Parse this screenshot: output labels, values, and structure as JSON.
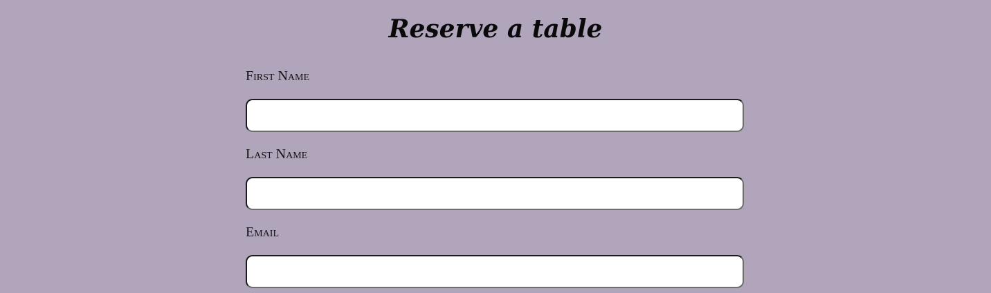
{
  "page": {
    "title": "Reserve a table",
    "background_color": "#b0a5ba"
  },
  "form": {
    "fields": [
      {
        "label": "First Name",
        "value": "",
        "placeholder": ""
      },
      {
        "label": "Last Name",
        "value": "",
        "placeholder": ""
      },
      {
        "label": "Email",
        "value": "",
        "placeholder": ""
      }
    ]
  }
}
